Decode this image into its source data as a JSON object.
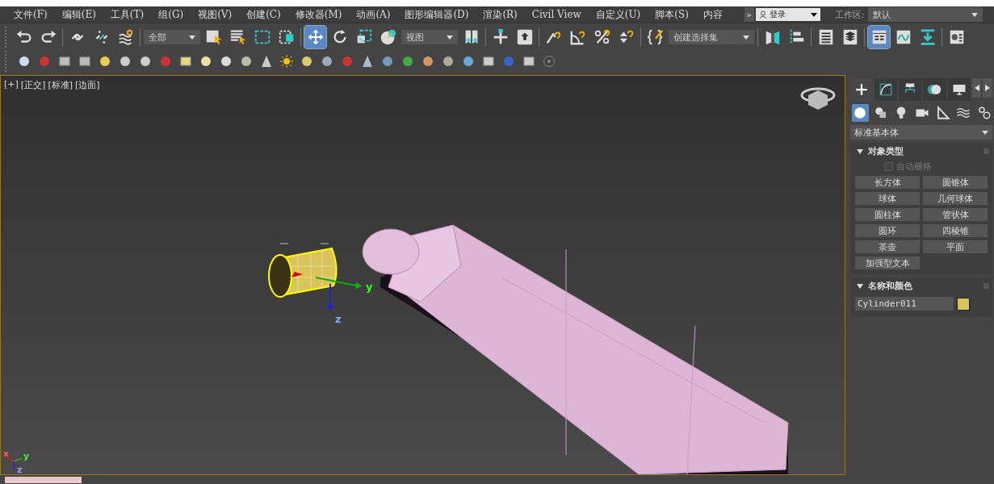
{
  "menu": {
    "items": [
      "文件(F)",
      "编辑(E)",
      "工具(T)",
      "组(G)",
      "视图(V)",
      "创建(C)",
      "修改器(M)",
      "动画(A)",
      "图形编辑器(D)",
      "渲染(R)",
      "Civil View",
      "自定义(U)",
      "脚本(S)",
      "内容"
    ],
    "overflow": "»",
    "login": "登录",
    "workspace_label": "工作区:",
    "workspace": "默认"
  },
  "toolbar_1": [
    {
      "kind": "icon",
      "selected": false
    },
    {
      "kind": "icon",
      "selected": false
    },
    {
      "kind": "sep"
    },
    {
      "kind": "icon",
      "selected": false
    },
    {
      "kind": "icon",
      "selected": false
    },
    {
      "kind": "icon",
      "selected": false
    },
    {
      "kind": "sep"
    },
    {
      "kind": "dropdown",
      "value": "全部"
    },
    {
      "kind": "icon",
      "selected": false
    },
    {
      "kind": "icon",
      "selected": false
    },
    {
      "kind": "icon",
      "selected": false
    },
    {
      "kind": "icon",
      "selected": false
    },
    {
      "kind": "sep"
    },
    {
      "kind": "icon",
      "selected": true
    },
    {
      "kind": "icon",
      "selected": false
    },
    {
      "kind": "icon",
      "selected": false
    },
    {
      "kind": "icon",
      "selected": false
    },
    {
      "kind": "dropdown",
      "value": "视图"
    },
    {
      "kind": "icon",
      "selected": false
    },
    {
      "kind": "sep"
    },
    {
      "kind": "icon",
      "selected": false
    },
    {
      "kind": "icon",
      "selected": false
    },
    {
      "kind": "sep"
    },
    {
      "kind": "icon",
      "selected": false
    },
    {
      "kind": "icon",
      "selected": false
    },
    {
      "kind": "icon",
      "selected": false
    },
    {
      "kind": "icon",
      "selected": false
    },
    {
      "kind": "sep"
    },
    {
      "kind": "icon",
      "selected": false
    },
    {
      "kind": "dropdown",
      "value": "创建选择集"
    },
    {
      "kind": "sep"
    },
    {
      "kind": "icon",
      "selected": false
    },
    {
      "kind": "icon",
      "selected": false
    },
    {
      "kind": "sep"
    },
    {
      "kind": "icon",
      "selected": false
    },
    {
      "kind": "icon",
      "selected": false
    },
    {
      "kind": "sep"
    },
    {
      "kind": "icon",
      "selected": true
    },
    {
      "kind": "icon",
      "selected": false
    },
    {
      "kind": "icon",
      "selected": false
    },
    {
      "kind": "sep"
    },
    {
      "kind": "icon",
      "selected": false
    }
  ],
  "viewport": {
    "labels": [
      "[+]",
      "[正交]",
      "[标准]",
      "[边面]"
    ],
    "gizmo_labels": [
      "y",
      "z"
    ],
    "tripod_labels": [
      "x",
      "y",
      "z"
    ]
  },
  "command_panel": {
    "tabs": [
      {
        "selected": true
      },
      {
        "selected": false
      },
      {
        "selected": false
      },
      {
        "selected": false
      },
      {
        "selected": false
      }
    ],
    "categories": [
      {
        "selected": true
      },
      {
        "selected": false
      },
      {
        "selected": false
      },
      {
        "selected": false
      },
      {
        "selected": false
      },
      {
        "selected": false
      },
      {
        "selected": false
      }
    ],
    "dropdown": "标准基本体",
    "object_type": {
      "title": "对象类型",
      "expanded": true,
      "autogrid": {
        "label": "自动栅格",
        "checked": false,
        "disabled": true
      },
      "buttons": [
        "长方体",
        "圆锥体",
        "球体",
        "几何球体",
        "圆柱体",
        "管状体",
        "圆环",
        "四棱锥",
        "茶壶",
        "平面",
        "加强型文本"
      ]
    },
    "name_color": {
      "title": "名称和颜色",
      "expanded": true,
      "name": "Cylinder011",
      "color": "#d9c35b"
    }
  }
}
